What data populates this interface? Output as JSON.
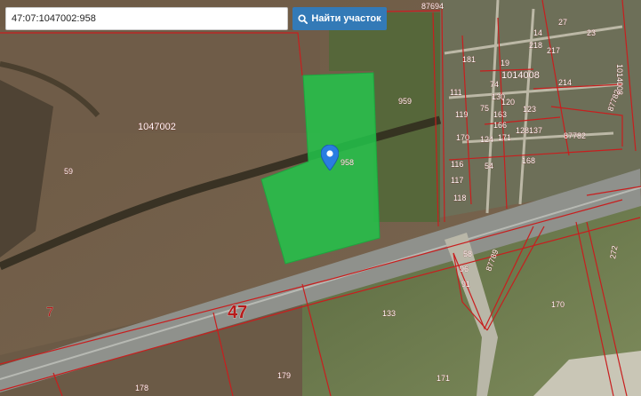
{
  "search": {
    "value": "47:07:1047002:958",
    "button_label": "Найти участок",
    "button_icon": "search-icon"
  },
  "colors": {
    "parcel_border": "#c81e1e",
    "selected_fill": "#22c44a",
    "button": "#337ab7"
  },
  "map": {
    "selected_parcel_label": "958",
    "marker_icon": "map-pin-icon",
    "labels": {
      "block_1047002": "1047002",
      "p959": "959",
      "p59": "59",
      "road_47": "47",
      "zone_7": "7",
      "p133": "133",
      "p170": "170",
      "p179": "179",
      "p178": "178",
      "p171": "171",
      "p87694": "87694",
      "block_1014008a": "1014008",
      "block_1014008b": "1014008",
      "p87782a": "87782",
      "p87782b": "87782",
      "p168": "168",
      "p54": "54",
      "p116": "116",
      "p117": "117",
      "p118": "118",
      "p58": "58",
      "p96": "96",
      "p91": "91",
      "p87789": "87789",
      "p272": "272",
      "v1": "181",
      "v2": "111",
      "v3": "119",
      "v4": "170",
      "v5": "75",
      "v6": "130",
      "v7": "163",
      "v8": "166",
      "v9": "120",
      "v10": "123",
      "v11": "171",
      "v12": "128",
      "v13": "137",
      "v14": "124",
      "v15": "19",
      "v16": "74",
      "v17": "14",
      "v18": "27",
      "v19": "218",
      "v20": "217",
      "v21": "214",
      "v22": "23"
    }
  }
}
